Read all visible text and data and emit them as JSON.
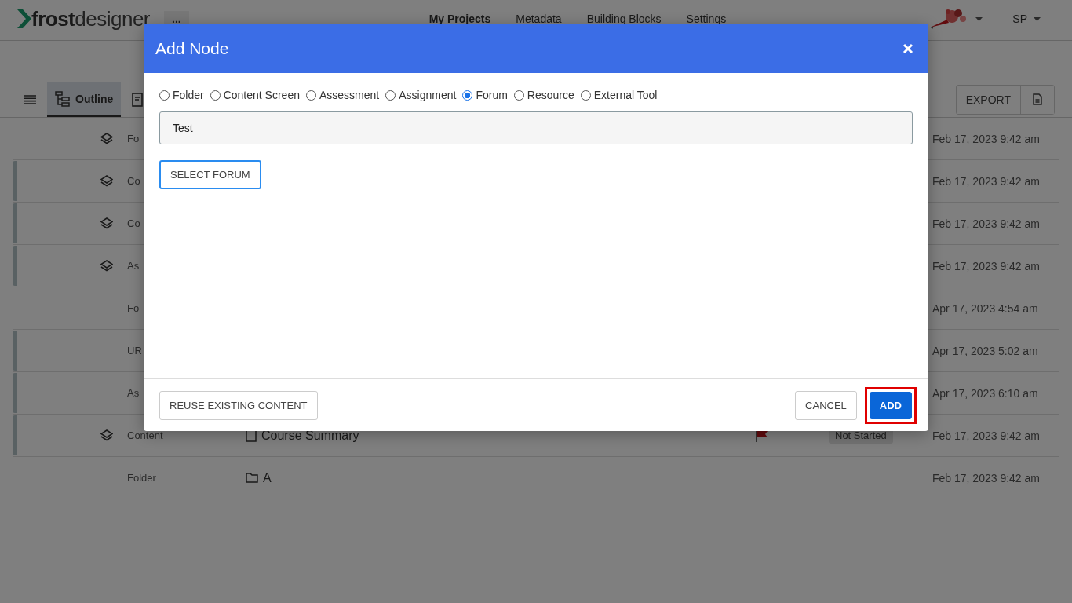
{
  "header": {
    "logo": {
      "bold": "frost",
      "light": "designer"
    },
    "more": "...",
    "nav": [
      {
        "label": "My Projects",
        "selected": true
      },
      {
        "label": "Metadata",
        "selected": false
      },
      {
        "label": "Building Blocks",
        "selected": false
      },
      {
        "label": "Settings",
        "selected": false
      }
    ],
    "user": "SP"
  },
  "toolbar": {
    "tabs": [
      {
        "label": "Outline",
        "selected": true
      }
    ],
    "export": "EXPORT"
  },
  "rows": [
    {
      "grouped": false,
      "layered": true,
      "type": "Fo",
      "date": "Feb 17, 2023 9:42 am"
    },
    {
      "grouped": true,
      "layered": true,
      "type": "Co",
      "date": "Feb 17, 2023 9:42 am"
    },
    {
      "grouped": true,
      "layered": true,
      "type": "Co",
      "date": "Feb 17, 2023 9:42 am"
    },
    {
      "grouped": true,
      "layered": true,
      "type": "As",
      "date": "Feb 17, 2023 9:42 am"
    },
    {
      "grouped": false,
      "layered": false,
      "type": "Fo",
      "date": "Apr 17, 2023 4:54 am"
    },
    {
      "grouped": true,
      "layered": false,
      "type": "UR",
      "date": "Apr 17, 2023 5:02 am"
    },
    {
      "grouped": true,
      "layered": false,
      "type": "As",
      "date": "Apr 17, 2023 6:10 am"
    },
    {
      "grouped": true,
      "layered": true,
      "type": "Content",
      "kind": "page",
      "title": "Course Summary",
      "flagged": true,
      "status": "Not Started",
      "date": "Feb 17, 2023 9:42 am"
    },
    {
      "grouped": false,
      "layered": false,
      "type": "Folder",
      "kind": "folder",
      "title": "A",
      "flagged": false,
      "date": "Feb 17, 2023 9:42 am"
    }
  ],
  "dialog": {
    "title": "Add Node",
    "options": [
      {
        "label": "Folder",
        "selected": false
      },
      {
        "label": "Content Screen",
        "selected": false
      },
      {
        "label": "Assessment",
        "selected": false
      },
      {
        "label": "Assignment",
        "selected": false
      },
      {
        "label": "Forum",
        "selected": true
      },
      {
        "label": "Resource",
        "selected": false
      },
      {
        "label": "External Tool",
        "selected": false
      }
    ],
    "name_field": {
      "value": "Test"
    },
    "select_button": "SELECT FORUM",
    "reuse_button": "REUSE EXISTING CONTENT",
    "cancel_button": "CANCEL",
    "add_button": {
      "label": "ADD",
      "highlighted": true
    }
  }
}
